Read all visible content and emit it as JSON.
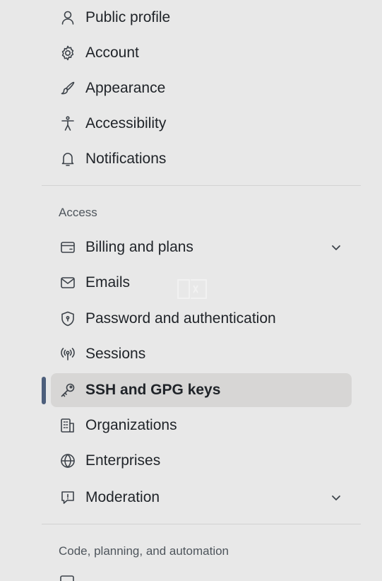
{
  "nav": {
    "top_items": [
      {
        "label": "Public profile",
        "icon": "person-icon"
      },
      {
        "label": "Account",
        "icon": "gear-icon"
      },
      {
        "label": "Appearance",
        "icon": "paintbrush-icon"
      },
      {
        "label": "Accessibility",
        "icon": "accessibility-icon"
      },
      {
        "label": "Notifications",
        "icon": "bell-icon"
      }
    ],
    "access_heading": "Access",
    "access_items": [
      {
        "label": "Billing and plans",
        "icon": "credit-card-icon",
        "expandable": true
      },
      {
        "label": "Emails",
        "icon": "mail-icon"
      },
      {
        "label": "Password and authentication",
        "icon": "shield-lock-icon"
      },
      {
        "label": "Sessions",
        "icon": "broadcast-icon"
      },
      {
        "label": "SSH and GPG keys",
        "icon": "key-icon",
        "active": true
      },
      {
        "label": "Organizations",
        "icon": "organization-icon"
      },
      {
        "label": "Enterprises",
        "icon": "globe-icon"
      },
      {
        "label": "Moderation",
        "icon": "report-icon",
        "expandable": true
      }
    ],
    "code_heading": "Code, planning, and automation"
  },
  "colors": {
    "background": "#e8e8e8",
    "active_item_bg": "#d7d6d5",
    "active_indicator": "#4d5f7c",
    "text": "#1f2328",
    "heading_text": "#4e555c"
  }
}
